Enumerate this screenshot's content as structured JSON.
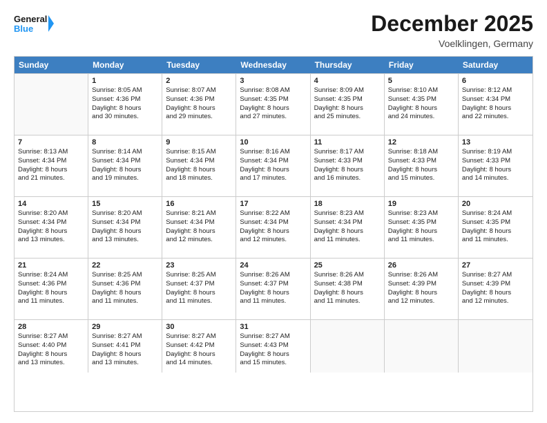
{
  "logo": {
    "line1": "General",
    "line2": "Blue",
    "icon": "▶"
  },
  "title": "December 2025",
  "location": "Voelklingen, Germany",
  "days": [
    "Sunday",
    "Monday",
    "Tuesday",
    "Wednesday",
    "Thursday",
    "Friday",
    "Saturday"
  ],
  "weeks": [
    [
      {
        "date": "",
        "info": ""
      },
      {
        "date": "1",
        "info": "Sunrise: 8:05 AM\nSunset: 4:36 PM\nDaylight: 8 hours\nand 30 minutes."
      },
      {
        "date": "2",
        "info": "Sunrise: 8:07 AM\nSunset: 4:36 PM\nDaylight: 8 hours\nand 29 minutes."
      },
      {
        "date": "3",
        "info": "Sunrise: 8:08 AM\nSunset: 4:35 PM\nDaylight: 8 hours\nand 27 minutes."
      },
      {
        "date": "4",
        "info": "Sunrise: 8:09 AM\nSunset: 4:35 PM\nDaylight: 8 hours\nand 25 minutes."
      },
      {
        "date": "5",
        "info": "Sunrise: 8:10 AM\nSunset: 4:35 PM\nDaylight: 8 hours\nand 24 minutes."
      },
      {
        "date": "6",
        "info": "Sunrise: 8:12 AM\nSunset: 4:34 PM\nDaylight: 8 hours\nand 22 minutes."
      }
    ],
    [
      {
        "date": "7",
        "info": "Sunrise: 8:13 AM\nSunset: 4:34 PM\nDaylight: 8 hours\nand 21 minutes."
      },
      {
        "date": "8",
        "info": "Sunrise: 8:14 AM\nSunset: 4:34 PM\nDaylight: 8 hours\nand 19 minutes."
      },
      {
        "date": "9",
        "info": "Sunrise: 8:15 AM\nSunset: 4:34 PM\nDaylight: 8 hours\nand 18 minutes."
      },
      {
        "date": "10",
        "info": "Sunrise: 8:16 AM\nSunset: 4:34 PM\nDaylight: 8 hours\nand 17 minutes."
      },
      {
        "date": "11",
        "info": "Sunrise: 8:17 AM\nSunset: 4:33 PM\nDaylight: 8 hours\nand 16 minutes."
      },
      {
        "date": "12",
        "info": "Sunrise: 8:18 AM\nSunset: 4:33 PM\nDaylight: 8 hours\nand 15 minutes."
      },
      {
        "date": "13",
        "info": "Sunrise: 8:19 AM\nSunset: 4:33 PM\nDaylight: 8 hours\nand 14 minutes."
      }
    ],
    [
      {
        "date": "14",
        "info": "Sunrise: 8:20 AM\nSunset: 4:34 PM\nDaylight: 8 hours\nand 13 minutes."
      },
      {
        "date": "15",
        "info": "Sunrise: 8:20 AM\nSunset: 4:34 PM\nDaylight: 8 hours\nand 13 minutes."
      },
      {
        "date": "16",
        "info": "Sunrise: 8:21 AM\nSunset: 4:34 PM\nDaylight: 8 hours\nand 12 minutes."
      },
      {
        "date": "17",
        "info": "Sunrise: 8:22 AM\nSunset: 4:34 PM\nDaylight: 8 hours\nand 12 minutes."
      },
      {
        "date": "18",
        "info": "Sunrise: 8:23 AM\nSunset: 4:34 PM\nDaylight: 8 hours\nand 11 minutes."
      },
      {
        "date": "19",
        "info": "Sunrise: 8:23 AM\nSunset: 4:35 PM\nDaylight: 8 hours\nand 11 minutes."
      },
      {
        "date": "20",
        "info": "Sunrise: 8:24 AM\nSunset: 4:35 PM\nDaylight: 8 hours\nand 11 minutes."
      }
    ],
    [
      {
        "date": "21",
        "info": "Sunrise: 8:24 AM\nSunset: 4:36 PM\nDaylight: 8 hours\nand 11 minutes."
      },
      {
        "date": "22",
        "info": "Sunrise: 8:25 AM\nSunset: 4:36 PM\nDaylight: 8 hours\nand 11 minutes."
      },
      {
        "date": "23",
        "info": "Sunrise: 8:25 AM\nSunset: 4:37 PM\nDaylight: 8 hours\nand 11 minutes."
      },
      {
        "date": "24",
        "info": "Sunrise: 8:26 AM\nSunset: 4:37 PM\nDaylight: 8 hours\nand 11 minutes."
      },
      {
        "date": "25",
        "info": "Sunrise: 8:26 AM\nSunset: 4:38 PM\nDaylight: 8 hours\nand 11 minutes."
      },
      {
        "date": "26",
        "info": "Sunrise: 8:26 AM\nSunset: 4:39 PM\nDaylight: 8 hours\nand 12 minutes."
      },
      {
        "date": "27",
        "info": "Sunrise: 8:27 AM\nSunset: 4:39 PM\nDaylight: 8 hours\nand 12 minutes."
      }
    ],
    [
      {
        "date": "28",
        "info": "Sunrise: 8:27 AM\nSunset: 4:40 PM\nDaylight: 8 hours\nand 13 minutes."
      },
      {
        "date": "29",
        "info": "Sunrise: 8:27 AM\nSunset: 4:41 PM\nDaylight: 8 hours\nand 13 minutes."
      },
      {
        "date": "30",
        "info": "Sunrise: 8:27 AM\nSunset: 4:42 PM\nDaylight: 8 hours\nand 14 minutes."
      },
      {
        "date": "31",
        "info": "Sunrise: 8:27 AM\nSunset: 4:43 PM\nDaylight: 8 hours\nand 15 minutes."
      },
      {
        "date": "",
        "info": ""
      },
      {
        "date": "",
        "info": ""
      },
      {
        "date": "",
        "info": ""
      }
    ]
  ]
}
